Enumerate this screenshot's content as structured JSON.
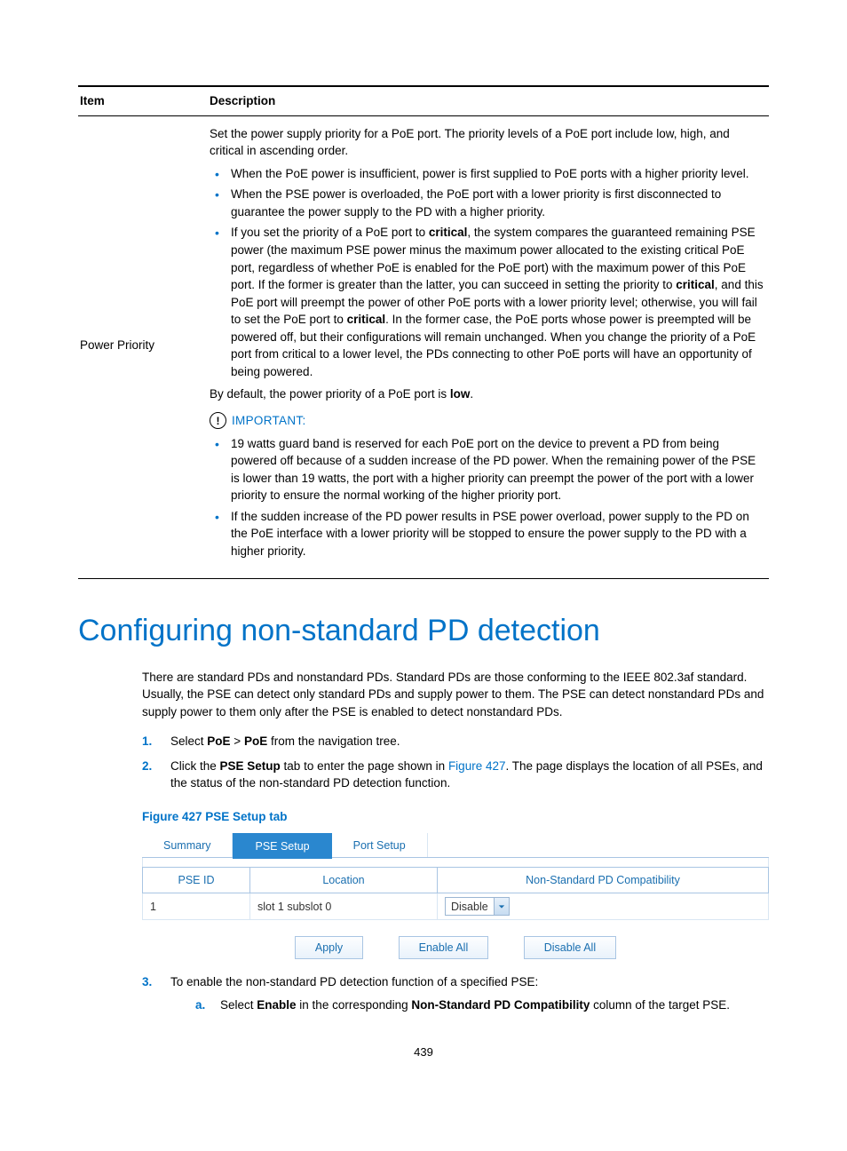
{
  "table": {
    "headers": {
      "item": "Item",
      "desc": "Description"
    },
    "row": {
      "item": "Power Priority",
      "intro": "Set the power supply priority for a PoE port. The priority levels of a PoE port include low, high, and critical in ascending order.",
      "bullets1": [
        "When the PoE power is insufficient, power is first supplied to PoE ports with a higher priority level.",
        "When the PSE power is overloaded, the PoE port with a lower priority is first disconnected to guarantee the power supply to the PD with a higher priority."
      ],
      "bullet_crit_pre": "If you set the priority of a PoE port to ",
      "bullet_crit_b1": "critical",
      "bullet_crit_mid1": ", the system compares the guaranteed remaining PSE power (the maximum PSE power minus the maximum power allocated to the existing critical PoE port, regardless of whether PoE is enabled for the PoE port) with the maximum power of this PoE port. If the former is greater than the latter, you can succeed in setting the priority to ",
      "bullet_crit_b2": "critical",
      "bullet_crit_mid2": ", and this PoE port will preempt the power of other PoE ports with a lower priority level; otherwise, you will fail to set the PoE port to ",
      "bullet_crit_b3": "critical",
      "bullet_crit_end": ". In the former case, the PoE ports whose power is preempted will be powered off, but their configurations will remain unchanged. When you change the priority of a PoE port from critical to a lower level, the PDs connecting to other PoE ports will have an opportunity of being powered.",
      "default_pre": "By default, the power priority of a PoE port is ",
      "default_b": "low",
      "default_post": ".",
      "important_label": "IMPORTANT:",
      "bullets2": [
        "19 watts guard band is reserved for each PoE port on the device to prevent a PD from being powered off because of a sudden increase of the PD power. When the remaining power of the PSE is lower than 19 watts, the port with a higher priority can preempt the power of the port with a lower priority to ensure the normal working of the higher priority port.",
        "If the sudden increase of the PD power results in PSE power overload, power supply to the PD on the PoE interface with a lower priority will be stopped to ensure the power supply to the PD with a higher priority."
      ]
    }
  },
  "section_title": "Configuring non-standard PD detection",
  "para": "There are standard PDs and nonstandard PDs. Standard PDs are those conforming to the IEEE 802.3af standard. Usually, the PSE can detect only standard PDs and supply power to them. The PSE can detect nonstandard PDs and supply power to them only after the PSE is enabled to detect nonstandard PDs.",
  "steps": {
    "s1_pre": "Select ",
    "s1_b1": "PoE",
    "s1_gt": " > ",
    "s1_b2": "PoE",
    "s1_post": " from the navigation tree.",
    "s2_pre": "Click the ",
    "s2_b": "PSE Setup",
    "s2_mid": " tab to enter the page shown in ",
    "s2_link": "Figure 427",
    "s2_post": ". The page displays the location of all PSEs, and the status of the non-standard PD detection function.",
    "s3": "To enable the non-standard PD detection function of a specified PSE:",
    "s3a_pre": "Select ",
    "s3a_b1": "Enable",
    "s3a_mid": " in the corresponding ",
    "s3a_b2": "Non-Standard PD Compatibility",
    "s3a_post": " column of the target PSE."
  },
  "figure_caption": "Figure 427 PSE Setup tab",
  "pse": {
    "tabs": {
      "summary": "Summary",
      "pse_setup": "PSE Setup",
      "port_setup": "Port Setup"
    },
    "headers": {
      "id": "PSE ID",
      "loc": "Location",
      "compat": "Non-Standard PD Compatibility"
    },
    "row": {
      "id": "1",
      "loc": "slot 1 subslot 0",
      "compat": "Disable"
    },
    "buttons": {
      "apply": "Apply",
      "enable_all": "Enable All",
      "disable_all": "Disable All"
    }
  },
  "page_number": "439"
}
